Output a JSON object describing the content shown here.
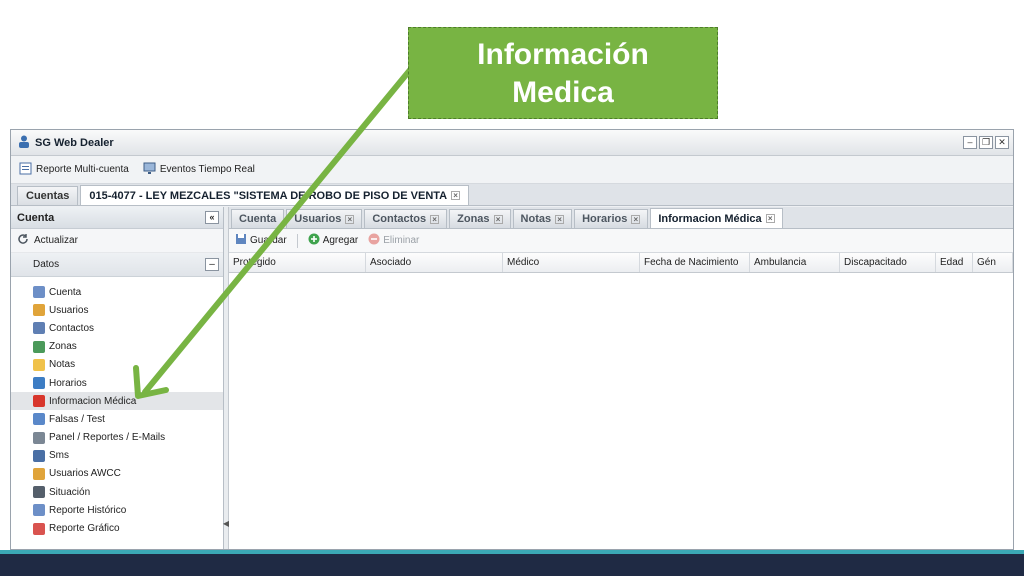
{
  "callout": {
    "line1": "Información",
    "line2": "Medica"
  },
  "window": {
    "title": "SG Web Dealer",
    "buttons": [
      "–",
      "❐",
      "✕"
    ]
  },
  "toolbar": {
    "multi_account_label": "Reporte Multi-cuenta",
    "realtime_events_label": "Eventos Tiempo Real"
  },
  "outer_tabs": [
    {
      "label": "Cuentas"
    },
    {
      "label": "015-4077 - LEY MEZCALES \"SISTEMA DE ROBO DE PISO DE VENTA"
    }
  ],
  "sidebar": {
    "title": "Cuenta",
    "collapse_label": "«",
    "refresh_label": "Actualizar",
    "section_label": "Datos",
    "section_toggle": "–",
    "items": [
      {
        "label": "Cuenta",
        "icon": "account-card-icon",
        "color": "#6d8fc7"
      },
      {
        "label": "Usuarios",
        "icon": "users-icon",
        "color": "#e0a43a"
      },
      {
        "label": "Contactos",
        "icon": "contacts-icon",
        "color": "#5f7fb3"
      },
      {
        "label": "Zonas",
        "icon": "zones-icon",
        "color": "#4b9a5a"
      },
      {
        "label": "Notas",
        "icon": "notes-icon",
        "color": "#f0c24a"
      },
      {
        "label": "Horarios",
        "icon": "clock-icon",
        "color": "#3d7dc4"
      },
      {
        "label": "Informacion Médica",
        "icon": "medical-icon",
        "color": "#d8362c"
      },
      {
        "label": "Falsas / Test",
        "icon": "pen-icon",
        "color": "#5a88c9"
      },
      {
        "label": "Panel / Reportes / E-Mails",
        "icon": "wrench-icon",
        "color": "#7b8794"
      },
      {
        "label": "Sms",
        "icon": "phone-icon",
        "color": "#4a6fa5"
      },
      {
        "label": "Usuarios AWCC",
        "icon": "users-awcc-icon",
        "color": "#e0a43a"
      },
      {
        "label": "Situación",
        "icon": "building-icon",
        "color": "#555f6b"
      },
      {
        "label": "Reporte Histórico",
        "icon": "report-history-icon",
        "color": "#6d8fc7"
      },
      {
        "label": "Reporte Gráfico",
        "icon": "report-chart-icon",
        "color": "#d9534f"
      }
    ]
  },
  "inner_tabs": [
    {
      "label": "Cuenta",
      "closable": false
    },
    {
      "label": "Usuarios",
      "closable": true
    },
    {
      "label": "Contactos",
      "closable": true
    },
    {
      "label": "Zonas",
      "closable": true
    },
    {
      "label": "Notas",
      "closable": true
    },
    {
      "label": "Horarios",
      "closable": true
    },
    {
      "label": "Informacion Médica",
      "closable": true
    }
  ],
  "grid_toolbar": {
    "save_label": "Guardar",
    "add_label": "Agregar",
    "delete_label": "Eliminar"
  },
  "grid_columns": [
    "Protegido",
    "Asociado",
    "Médico",
    "Fecha de Nacimiento",
    "Ambulancia",
    "Discapacitado",
    "Edad",
    "Gén"
  ],
  "colors": {
    "callout": "#78b443",
    "arrow": "#78b443",
    "slide_band": "#1f2a44",
    "accent_band": "#3ba8b5"
  }
}
